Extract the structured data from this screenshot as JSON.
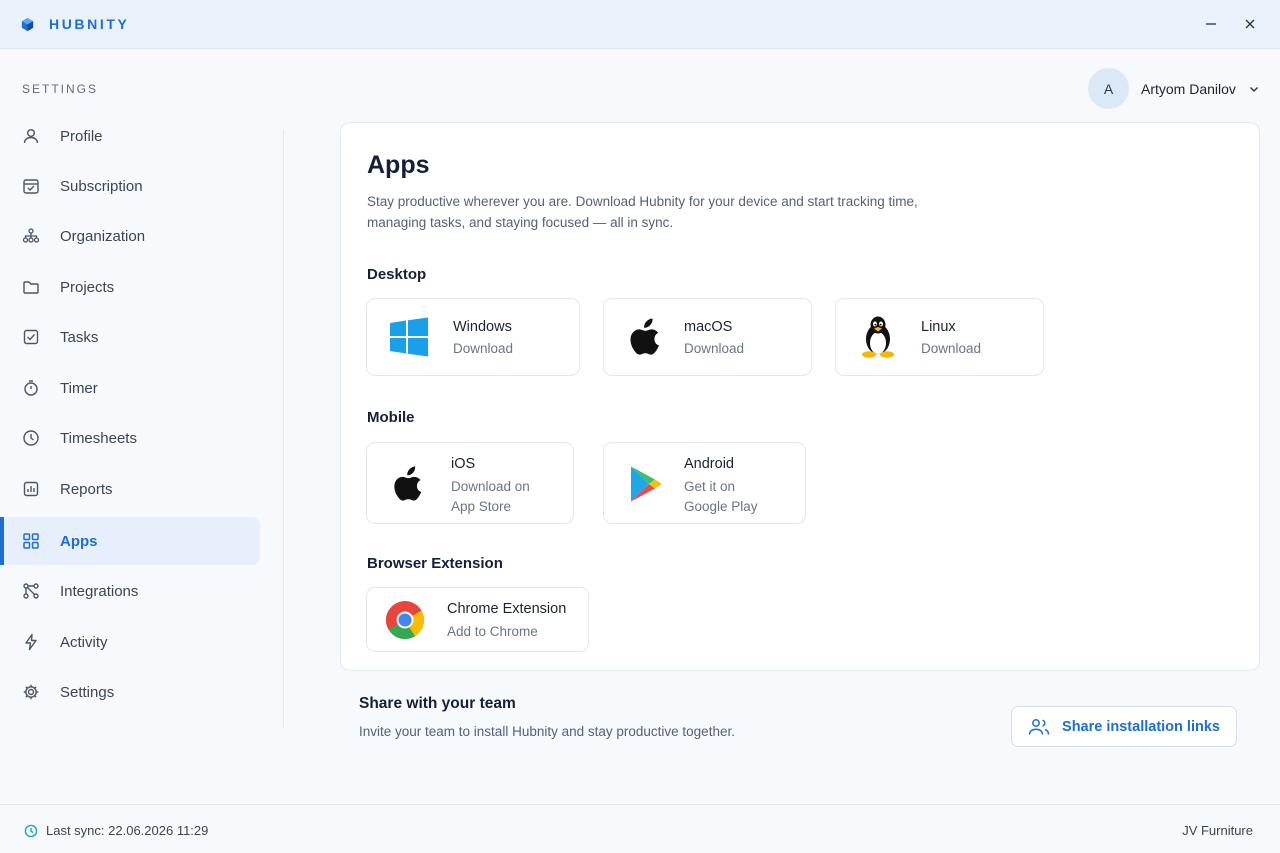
{
  "titlebar": {
    "brand": "HUBNITY",
    "brand_color": "#1d6fd1"
  },
  "sidebar": {
    "heading": "SETTINGS",
    "items": [
      {
        "label": "Profile",
        "icon": "user-icon"
      },
      {
        "label": "Subscription",
        "icon": "calendar-check-icon"
      },
      {
        "label": "Organization",
        "icon": "org-chart-icon"
      },
      {
        "label": "Projects",
        "icon": "folder-icon"
      },
      {
        "label": "Tasks",
        "icon": "task-check-icon"
      },
      {
        "label": "Timer",
        "icon": "stopwatch-icon"
      },
      {
        "label": "Timesheets",
        "icon": "clock-icon"
      },
      {
        "label": "Reports",
        "icon": "chart-icon"
      },
      {
        "label": "Apps",
        "icon": "grid-icon",
        "active": true
      },
      {
        "label": "Integrations",
        "icon": "integrations-icon"
      },
      {
        "label": "Activity",
        "icon": "bolt-icon"
      },
      {
        "label": "Settings",
        "icon": "gear-icon"
      }
    ]
  },
  "user": {
    "initial": "A",
    "name": "Artyom Danilov"
  },
  "apps": {
    "title": "Apps",
    "description": "Stay productive wherever you are. Download Hubnity for your device and start tracking time, managing tasks, and staying focused — all in sync.",
    "desktop": {
      "label": "Desktop",
      "items": [
        {
          "name": "Windows",
          "action": "Download",
          "icon": "windows-icon"
        },
        {
          "name": "macOS",
          "action": "Download",
          "icon": "apple-icon"
        },
        {
          "name": "Linux",
          "action": "Download",
          "icon": "linux-tux-icon"
        }
      ]
    },
    "mobile": {
      "label": "Mobile",
      "items": [
        {
          "name": "iOS",
          "action_line1": "Download on",
          "action_line2": "App Store",
          "icon": "apple-icon"
        },
        {
          "name": "Android",
          "action_line1": "Get it on",
          "action_line2": "Google Play",
          "icon": "google-play-icon"
        }
      ]
    },
    "browser": {
      "label": "Browser Extension",
      "items": [
        {
          "name": "Chrome Extension",
          "action": "Add to Chrome",
          "icon": "chrome-icon"
        }
      ]
    }
  },
  "share": {
    "title": "Share with your team",
    "description": "Invite your team to install Hubnity and stay productive together.",
    "button": "Share installation links"
  },
  "footer": {
    "sync": "Last sync: 22.06.2026 11:29",
    "org": "JV Furniture"
  },
  "colors": {
    "accent": "#1d6fd1",
    "sync_icon": "#18a6b8"
  }
}
